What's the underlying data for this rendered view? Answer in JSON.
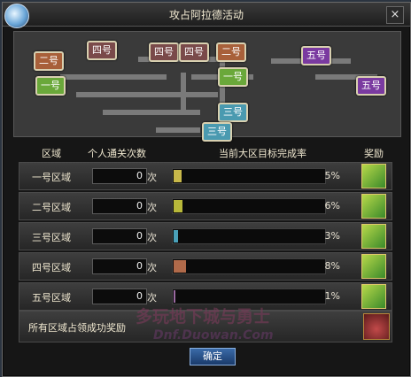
{
  "window": {
    "title": "攻占阿拉德活动"
  },
  "map": {
    "nodes": [
      "二号",
      "一号",
      "四号",
      "四号",
      "四号",
      "二号",
      "一号",
      "三号",
      "三号",
      "五号",
      "五号"
    ]
  },
  "table": {
    "headers": [
      "区域",
      "个人通关次数",
      "当前大区目标完成率",
      "奖励"
    ],
    "unit": "次",
    "rows": [
      {
        "zone": "一号区域",
        "count": "0",
        "pct_text": "5%",
        "fill": 0.05,
        "color": "#c8b84a"
      },
      {
        "zone": "二号区域",
        "count": "0",
        "pct_text": "6%",
        "fill": 0.06,
        "color": "#b8b83a"
      },
      {
        "zone": "三号区域",
        "count": "0",
        "pct_text": "3%",
        "fill": 0.03,
        "color": "#4aa0b8"
      },
      {
        "zone": "四号区域",
        "count": "0",
        "pct_text": "8%",
        "fill": 0.08,
        "color": "#b06a4a"
      },
      {
        "zone": "五号区域",
        "count": "0",
        "pct_text": "1%",
        "fill": 0.01,
        "color": "#9a6aa0"
      }
    ]
  },
  "footer": {
    "label": "所有区域占领成功奖励"
  },
  "watermark": {
    "line1": "多玩地下城与勇士",
    "line2": "Dnf.Duowan.Com"
  },
  "buttons": {
    "ok": "确定"
  }
}
